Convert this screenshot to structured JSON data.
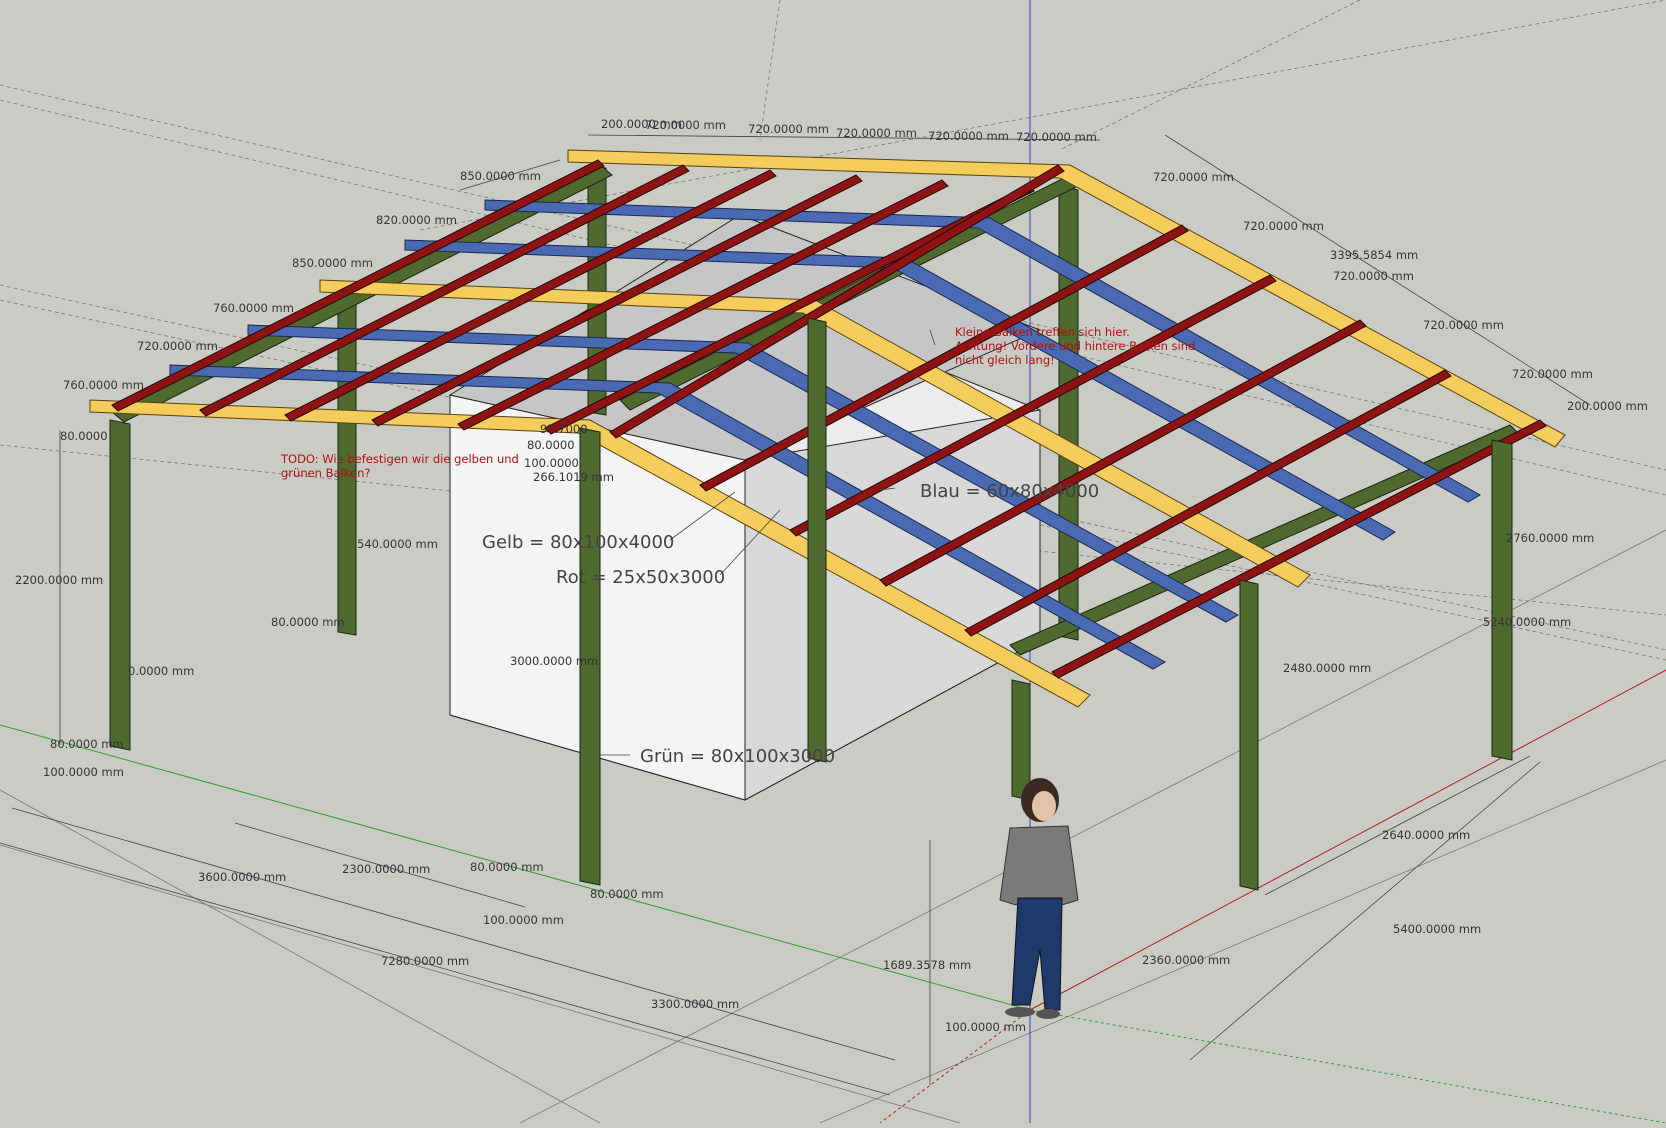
{
  "colors": {
    "background": "#cbcbc6",
    "green": "#4f6a2f",
    "yellow": "#f4cd5c",
    "blue": "#4a6bb3",
    "red": "#8e1414",
    "note": "#b01010",
    "axis_blue": "#3a3ad0",
    "axis_green": "#2ea02e",
    "axis_red": "#b02020"
  },
  "dimensions": [
    "200.0000 mm",
    "720.0000 mm",
    "720.0000 mm",
    "720.0000 mm",
    "720.0000 mm",
    "720.0000 mm",
    "850.0000 mm",
    "820.0000 mm",
    "850.0000 mm",
    "760.0000 mm",
    "720.0000 mm",
    "760.0000 mm",
    "80.0000",
    "97.7000",
    "80.0000",
    "100.0000",
    "266.1019 mm",
    "2200.0000 mm",
    "540.0000 mm",
    "80.0000 mm",
    "0.0000 mm",
    "3000.0000 mm",
    "80.0000 mm",
    "100.0000 mm",
    "3600.0000 mm",
    "2300.0000 mm",
    "80.0000 mm",
    "100.0000 mm",
    "80.0000 mm",
    "7280.0000 mm",
    "3300.0000 mm",
    "1689.3578 mm",
    "100.0000 mm",
    "720.0000 mm",
    "720.0000 mm",
    "3395.5854 mm",
    "720.0000 mm",
    "720.0000 mm",
    "720.0000 mm",
    "200.0000 mm",
    "2760.0000 mm",
    "5240.0000 mm",
    "2480.0000 mm",
    "2640.0000 mm",
    "5400.0000 mm",
    "2360.0000 mm"
  ],
  "labels": {
    "gelb": "Gelb = 80x100x4000",
    "rot": "Rot = 25x50x3000",
    "blau": "Blau = 60x80x4000",
    "gruen": "Grün = 80x100x3000"
  },
  "notes": {
    "todo_line1": "TODO: Wie befestigen wir die gelben und",
    "todo_line2": "grünen Balken?",
    "klein_line1": "Kleine Balken treffen sich hier.",
    "klein_line2": "Achtung! Vordere und hintere Balken sind",
    "klein_line3": "nicht gleich lang!"
  }
}
